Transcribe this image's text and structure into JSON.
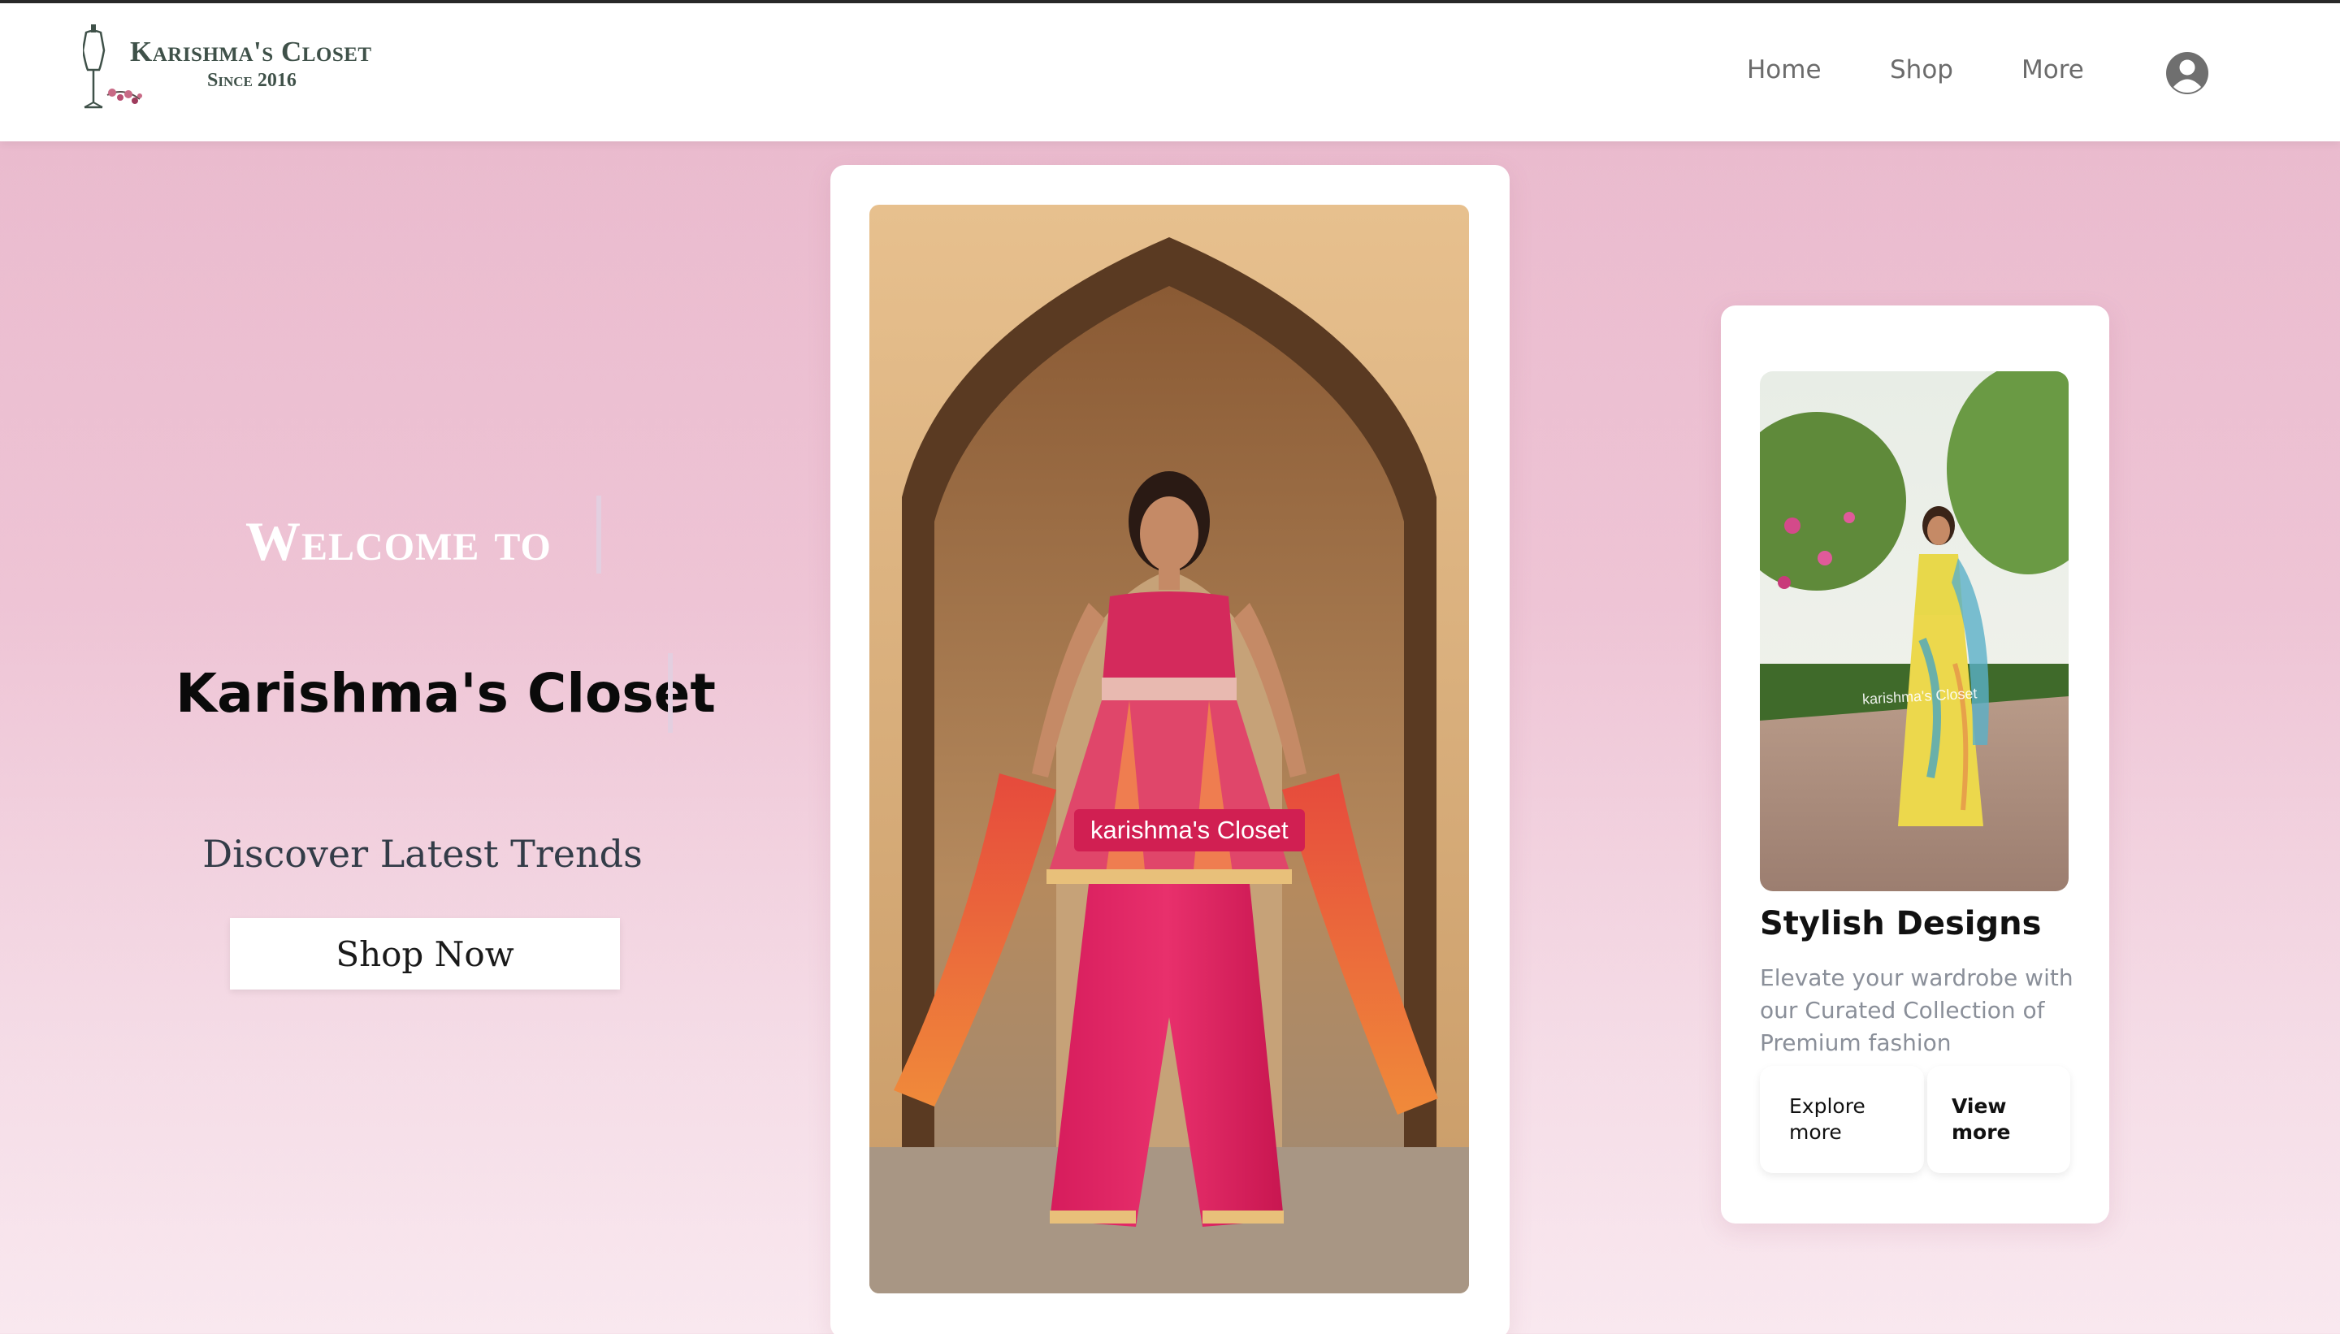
{
  "header": {
    "logo_title": "Karishma's Closet",
    "logo_subtitle": "Since 2016",
    "nav": [
      {
        "label": "Home"
      },
      {
        "label": "Shop"
      },
      {
        "label": "More"
      }
    ],
    "account_icon": "user-circle-icon"
  },
  "hero": {
    "welcome": "Welcome to",
    "brand": "Karishma's Closet",
    "tagline": "Discover Latest Trends",
    "cta": "Shop Now"
  },
  "main_card": {
    "tag": "karishma's Closet"
  },
  "side_card": {
    "watermark": "karishma's Closet",
    "title": "Stylish Designs",
    "description": "Elevate your wardrobe with our Curated Collection of Premium fashion",
    "explore_label": "Explore more",
    "view_label": "View more"
  },
  "colors": {
    "background_top": "#e9b8cc",
    "background_bottom": "#f9e8ef",
    "tag_red": "#d11f52",
    "logo_green": "#3f5149"
  }
}
